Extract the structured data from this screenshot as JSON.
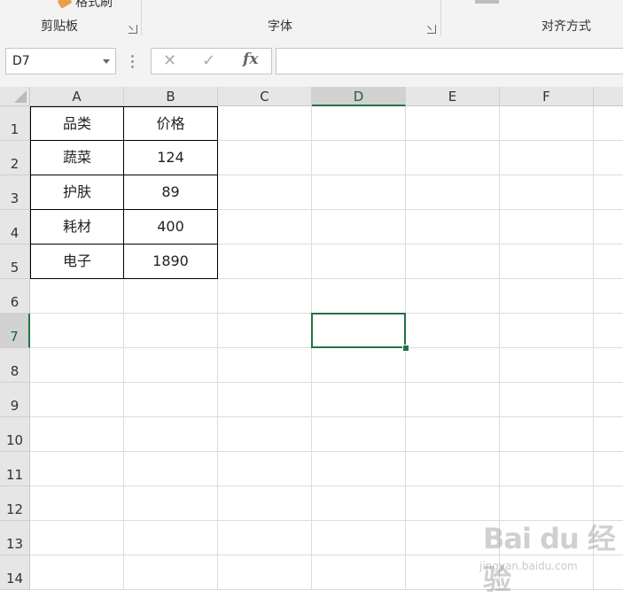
{
  "ribbon": {
    "clipboard": {
      "label": "剪贴板",
      "format_painter": "格式刷"
    },
    "font": {
      "label": "字体"
    },
    "alignment": {
      "label": "对齐方式"
    }
  },
  "formula_bar": {
    "name_box": "D7",
    "cancel_icon": "✕",
    "enter_icon": "✓",
    "fx_label": "fx",
    "formula": ""
  },
  "sheet": {
    "columns": [
      "A",
      "B",
      "C",
      "D",
      "E",
      "F"
    ],
    "rows": [
      "1",
      "2",
      "3",
      "4",
      "5",
      "6",
      "7",
      "8",
      "9",
      "10",
      "11",
      "12",
      "13",
      "14"
    ],
    "selected_cell": "D7",
    "table": [
      [
        "品类",
        "价格"
      ],
      [
        "蔬菜",
        "124"
      ],
      [
        "护肤",
        "89"
      ],
      [
        "耗材",
        "400"
      ],
      [
        "电子",
        "1890"
      ]
    ],
    "accent_color": "#217346"
  },
  "watermark": {
    "logo": "Bai du 经验",
    "url": "jingyan.baidu.com"
  }
}
